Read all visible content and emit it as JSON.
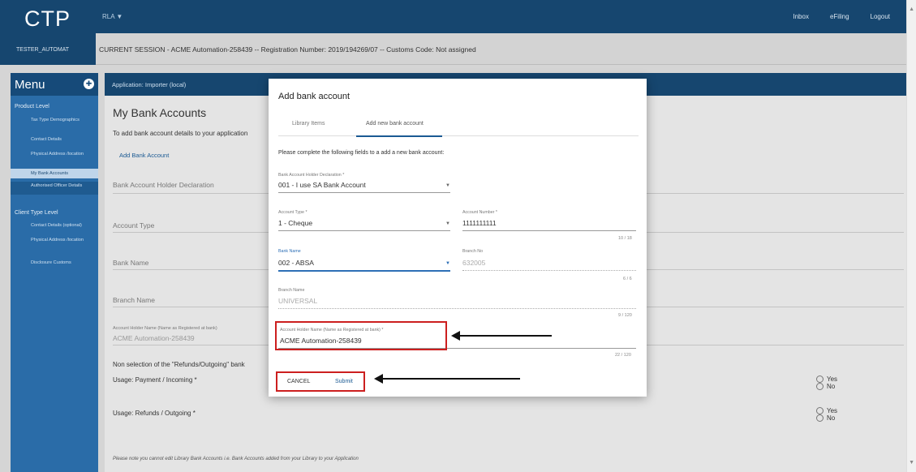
{
  "header": {
    "logo": "CTP",
    "app_menu": "RLA ▼",
    "links": [
      "Inbox",
      "eFiling",
      "Logout"
    ]
  },
  "session": {
    "user": "TESTER_AUTOMAT",
    "text": "CURRENT SESSION - ACME Automation-258439 -- Registration Number: 2019/194269/07 -- Customs Code: Not assigned"
  },
  "sidebar": {
    "title": "Menu",
    "product_level": "Product Level",
    "product_items": [
      "Tax Type Demographics",
      "Contact Details",
      "Physical Address /location",
      "My Bank Accounts",
      "Authorised Officer Details"
    ],
    "client_level": "Client Type Level",
    "client_items": [
      "Contact Details (optional)",
      "Physical Address /location",
      "Disclosure Customs"
    ]
  },
  "main": {
    "application": "Application: Importer (local)",
    "title": "My Bank Accounts",
    "intro": "To add bank account details to your application",
    "add_link": "Add Bank Account",
    "fields": [
      "Bank Account Holder Declaration",
      "Account Type",
      "Bank Name",
      "Branch Name"
    ],
    "holder_label": "Account Holder Name (Name as Registered at bank)",
    "holder_value": "ACME Automation-258439",
    "non_selection": "Non selection of the \"Refunds/Outgoing\" bank",
    "usage_payment": "Usage: Payment / Incoming *",
    "usage_refunds": "Usage: Refunds / Outgoing *",
    "yes": "Yes",
    "no": "No",
    "note": "Please note  you cannot edit Library Bank Accounts i.e. Bank Accounts added from your Library to your Application"
  },
  "modal": {
    "title": "Add bank account",
    "tab_library": "Library Items",
    "tab_new": "Add new bank account",
    "intro": "Please complete the following fields to a add a new bank account:",
    "decl_label": "Bank Account Holder Declaration *",
    "decl_value": "001 - I use SA Bank Account",
    "type_label": "Account Type *",
    "type_value": "1 - Cheque",
    "acct_label": "Account Number *",
    "acct_value": "1111111111",
    "acct_counter": "10 / 18",
    "bank_label": "Bank Name",
    "bank_value": "002 - ABSA",
    "branch_no_label": "Branch No",
    "branch_no_value": "632005",
    "branch_counter": "6 / 6",
    "branch_name_label": "Branch Name",
    "branch_name_value": "UNIVERSAL",
    "branch_name_counter": "9 / 120",
    "holder_label": "Account Holder Name (Name as Registered at bank) *",
    "holder_value": "ACME Automation-258439",
    "holder_counter": "22 / 120",
    "cancel": "CANCEL",
    "submit": "Submit"
  },
  "colors": {
    "header": "#16466f",
    "sidebar": "#2a6ca8",
    "accent": "#2d6fb6",
    "annotation": "#cc1f1f"
  }
}
